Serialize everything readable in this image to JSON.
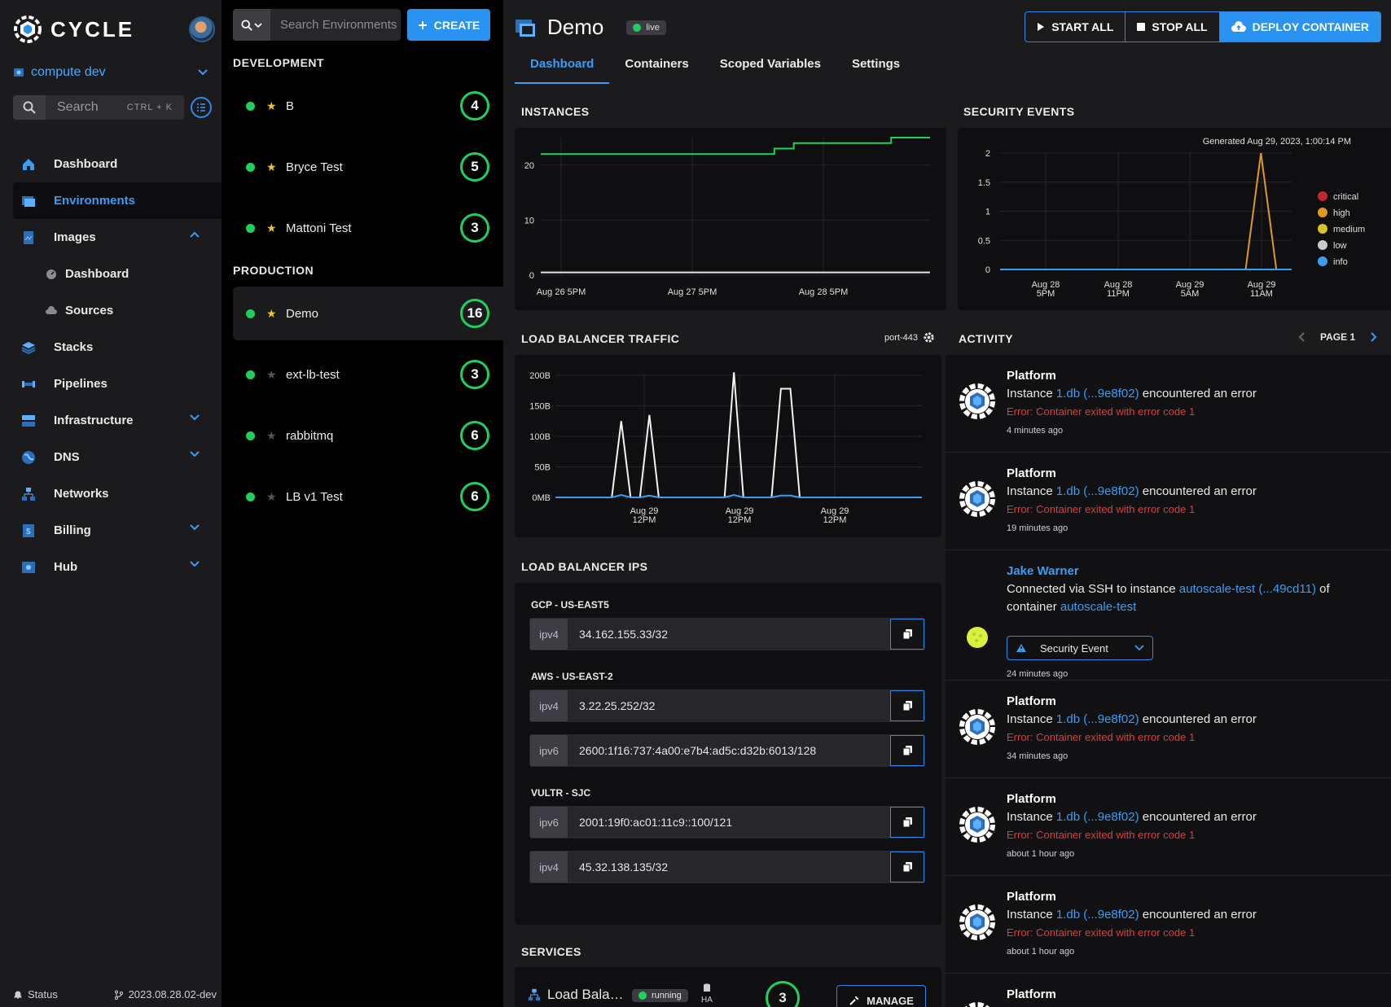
{
  "brand": {
    "name": "CYCLE"
  },
  "hub": {
    "name": "compute dev"
  },
  "search": {
    "placeholder": "Search",
    "shortcut": "CTRL + K"
  },
  "nav": {
    "dashboard": "Dashboard",
    "environments": "Environments",
    "images": "Images",
    "images_dashboard": "Dashboard",
    "images_sources": "Sources",
    "stacks": "Stacks",
    "pipelines": "Pipelines",
    "infrastructure": "Infrastructure",
    "dns": "DNS",
    "networks": "Networks",
    "billing": "Billing",
    "hub": "Hub"
  },
  "footer": {
    "status": "Status",
    "version": "2023.08.28.02-dev"
  },
  "envlist": {
    "search_placeholder": "Search Environments",
    "create_label": "CREATE",
    "development_label": "DEVELOPMENT",
    "production_label": "PRODUCTION",
    "development": [
      {
        "name": "B",
        "count": "4",
        "starred": true
      },
      {
        "name": "Bryce Test",
        "count": "5",
        "starred": true
      },
      {
        "name": "Mattoni Test",
        "count": "3",
        "starred": true
      }
    ],
    "production": [
      {
        "name": "Demo",
        "count": "16",
        "starred": true
      },
      {
        "name": "ext-lb-test",
        "count": "3",
        "starred": false
      },
      {
        "name": "rabbitmq",
        "count": "6",
        "starred": false
      },
      {
        "name": "LB v1 Test",
        "count": "6",
        "starred": false
      }
    ]
  },
  "header": {
    "title": "Demo",
    "status": "live",
    "start_all": "START ALL",
    "stop_all": "STOP ALL",
    "deploy": "DEPLOY CONTAINER"
  },
  "tabs": {
    "dashboard": "Dashboard",
    "containers": "Containers",
    "scoped_variables": "Scoped Variables",
    "settings": "Settings"
  },
  "sections": {
    "instances": "INSTANCES",
    "security_events": "SECURITY EVENTS",
    "lb_traffic": "LOAD BALANCER TRAFFIC",
    "lb_port": "port-443",
    "activity": "ACTIVITY",
    "page": "PAGE 1",
    "lb_ips": "LOAD BALANCER IPS",
    "services": "SERVICES"
  },
  "instances_chart": {
    "yticks": [
      "0",
      "10",
      "20"
    ],
    "xticks": [
      "Aug 26 5PM",
      "Aug 27 5PM",
      "Aug 28 5PM"
    ],
    "colors": {
      "running": "#1fd15a",
      "other": "#e6e6e6"
    }
  },
  "security_chart": {
    "generated": "Generated Aug 29, 2023, 1:00:14 PM",
    "yticks": [
      "0",
      "0.5",
      "1",
      "1.5",
      "2"
    ],
    "xticks": [
      [
        "Aug 28",
        "5PM"
      ],
      [
        "Aug 28",
        "11PM"
      ],
      [
        "Aug 29",
        "5AM"
      ],
      [
        "Aug 29",
        "11AM"
      ]
    ],
    "legend": [
      {
        "label": "critical",
        "color": "#c0262d"
      },
      {
        "label": "high",
        "color": "#e09a1e"
      },
      {
        "label": "medium",
        "color": "#d6c52c"
      },
      {
        "label": "low",
        "color": "#c9c9c9"
      },
      {
        "label": "info",
        "color": "#3c9cf0"
      }
    ]
  },
  "traffic_chart": {
    "yticks": [
      "0MB",
      "50B",
      "100B",
      "150B",
      "200B"
    ],
    "xticks": [
      [
        "Aug 29",
        "12PM"
      ],
      [
        "Aug 29",
        "12PM"
      ],
      [
        "Aug 29",
        "12PM"
      ]
    ]
  },
  "chart_data": [
    {
      "type": "line",
      "title": "INSTANCES",
      "ylim": [
        0,
        25
      ],
      "x": [
        "Aug 26 5PM",
        "Aug 27 5PM",
        "Aug 28 5PM"
      ],
      "series": [
        {
          "values": [
            22,
            22,
            22,
            22,
            22,
            22,
            22,
            22,
            22,
            22,
            22,
            22,
            23,
            24,
            24,
            24,
            24,
            24,
            25,
            25
          ]
        },
        {
          "values": [
            0.5,
            0.5,
            0.5,
            0.5,
            0.5,
            0.5,
            0.5,
            0.5,
            0.5,
            0.5,
            0.5,
            0.5,
            0.5,
            0.5,
            0.5,
            0.5,
            0.5,
            0.5,
            0.5,
            0.5
          ]
        }
      ]
    },
    {
      "type": "line",
      "title": "SECURITY EVENTS",
      "ylim": [
        0,
        2
      ],
      "x": [
        "Aug 28 5PM",
        "Aug 28 11PM",
        "Aug 29 5AM",
        "Aug 29 11AM"
      ],
      "series": [
        {
          "name": "high",
          "values": [
            0,
            0,
            0,
            0,
            0,
            0,
            0,
            0,
            0,
            0,
            0,
            0,
            0,
            0,
            0,
            0,
            0,
            2,
            0,
            0
          ]
        },
        {
          "name": "info",
          "values": [
            0,
            0,
            0,
            0,
            0,
            0,
            0,
            0,
            0,
            0,
            0,
            0,
            0,
            0,
            0,
            0,
            0,
            0,
            0,
            0
          ]
        }
      ]
    },
    {
      "type": "line",
      "title": "LOAD BALANCER TRAFFIC",
      "ylim": [
        0,
        200
      ],
      "series": [
        {
          "values": [
            0,
            0,
            0,
            0,
            0,
            0,
            0,
            125,
            0,
            0,
            135,
            0,
            0,
            0,
            0,
            0,
            0,
            0,
            0,
            205,
            0,
            0,
            0,
            0,
            178,
            178,
            0,
            0,
            0,
            0,
            0,
            0,
            0,
            0,
            0,
            0,
            0,
            0,
            0,
            0
          ]
        },
        {
          "values": [
            0,
            0,
            0,
            0,
            0,
            0,
            0,
            4,
            0,
            0,
            3,
            0,
            0,
            0,
            0,
            0,
            0,
            0,
            0,
            4,
            0,
            0,
            0,
            0,
            3,
            3,
            0,
            0,
            0,
            0,
            0,
            0,
            0,
            0,
            0,
            0,
            0,
            0,
            0,
            0
          ]
        }
      ]
    }
  ],
  "lb_ips": [
    {
      "provider": "GCP - US-EAST5",
      "rows": [
        {
          "type": "ipv4",
          "value": "34.162.155.33/32"
        }
      ]
    },
    {
      "provider": "AWS - US-EAST-2",
      "rows": [
        {
          "type": "ipv4",
          "value": "3.22.25.252/32"
        },
        {
          "type": "ipv6",
          "value": "2600:1f16:737:4a00:e7b4:ad5c:d32b:6013/128"
        }
      ]
    },
    {
      "provider": "VULTR - SJC",
      "rows": [
        {
          "type": "ipv6",
          "value": "2001:19f0:ac01:11c9::100/121"
        },
        {
          "type": "ipv4",
          "value": "45.32.138.135/32"
        }
      ]
    }
  ],
  "activity": [
    {
      "who": "Platform",
      "pre": "Instance ",
      "link": "1.db (...9e8f02)",
      "post": " encountered an error",
      "error": "Error: Container exited with error code 1",
      "time": "4 minutes ago"
    },
    {
      "who": "Platform",
      "pre": "Instance ",
      "link": "1.db (...9e8f02)",
      "post": " encountered an error",
      "error": "Error: Container exited with error code 1",
      "time": "19 minutes ago"
    },
    {
      "who": "Jake Warner",
      "pre": "Connected via SSH to instance ",
      "link": "autoscale-test (...49cd11)",
      "post": " of container ",
      "link2": "autoscale-test",
      "event": "Security Event",
      "time": "24 minutes ago"
    },
    {
      "who": "Platform",
      "pre": "Instance ",
      "link": "1.db (...9e8f02)",
      "post": " encountered an error",
      "error": "Error: Container exited with error code 1",
      "time": "34 minutes ago"
    },
    {
      "who": "Platform",
      "pre": "Instance ",
      "link": "1.db (...9e8f02)",
      "post": " encountered an error",
      "error": "Error: Container exited with error code 1",
      "time": "about 1 hour ago"
    },
    {
      "who": "Platform",
      "pre": "Instance ",
      "link": "1.db (...9e8f02)",
      "post": " encountered an error",
      "error": "Error: Container exited with error code 1",
      "time": "about 1 hour ago"
    },
    {
      "who": "Platform"
    }
  ],
  "service": {
    "name": "Load Bala…",
    "status": "running",
    "ha": "HA",
    "count": "3",
    "manage": "MANAGE"
  }
}
